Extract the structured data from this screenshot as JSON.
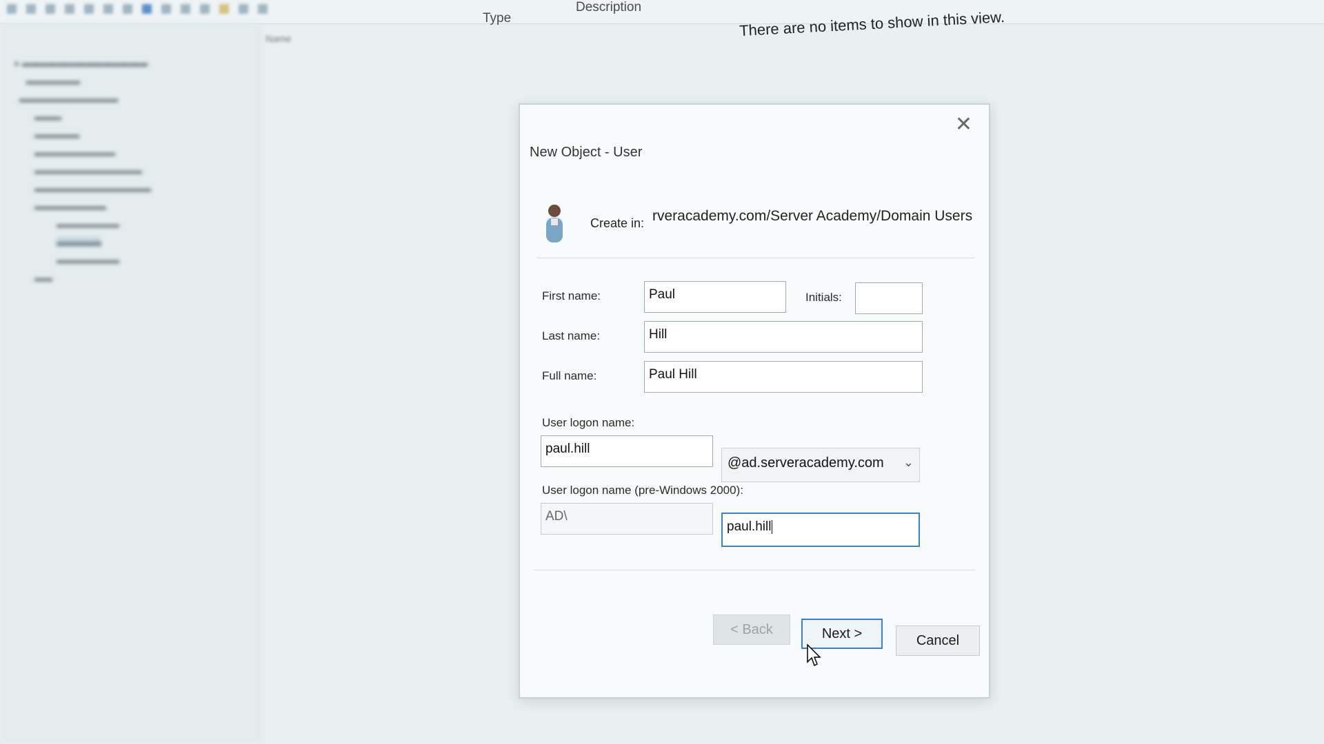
{
  "background": {
    "list_columns": {
      "type": "Type",
      "description": "Description"
    },
    "empty_message": "There are no items to show in this view."
  },
  "dialog": {
    "title": "New Object - User",
    "close_icon": "close-icon",
    "create_in_label": "Create in:",
    "create_in_path": "rveracademy.com/Server Academy/Domain Users",
    "first_name": {
      "label": "First name:",
      "value": "Paul"
    },
    "initials": {
      "label": "Initials:",
      "value": ""
    },
    "last_name": {
      "label": "Last name:",
      "value": "Hill"
    },
    "full_name": {
      "label": "Full name:",
      "value": "Paul Hill"
    },
    "logon_name": {
      "label": "User logon name:",
      "value": "paul.hill",
      "domain": "@ad.serveracademy.com"
    },
    "pre2000": {
      "label": "User logon name (pre-Windows 2000):",
      "prefix": "AD\\",
      "value": "paul.hill"
    },
    "buttons": {
      "back": "< Back",
      "next": "Next >",
      "cancel": "Cancel"
    }
  }
}
